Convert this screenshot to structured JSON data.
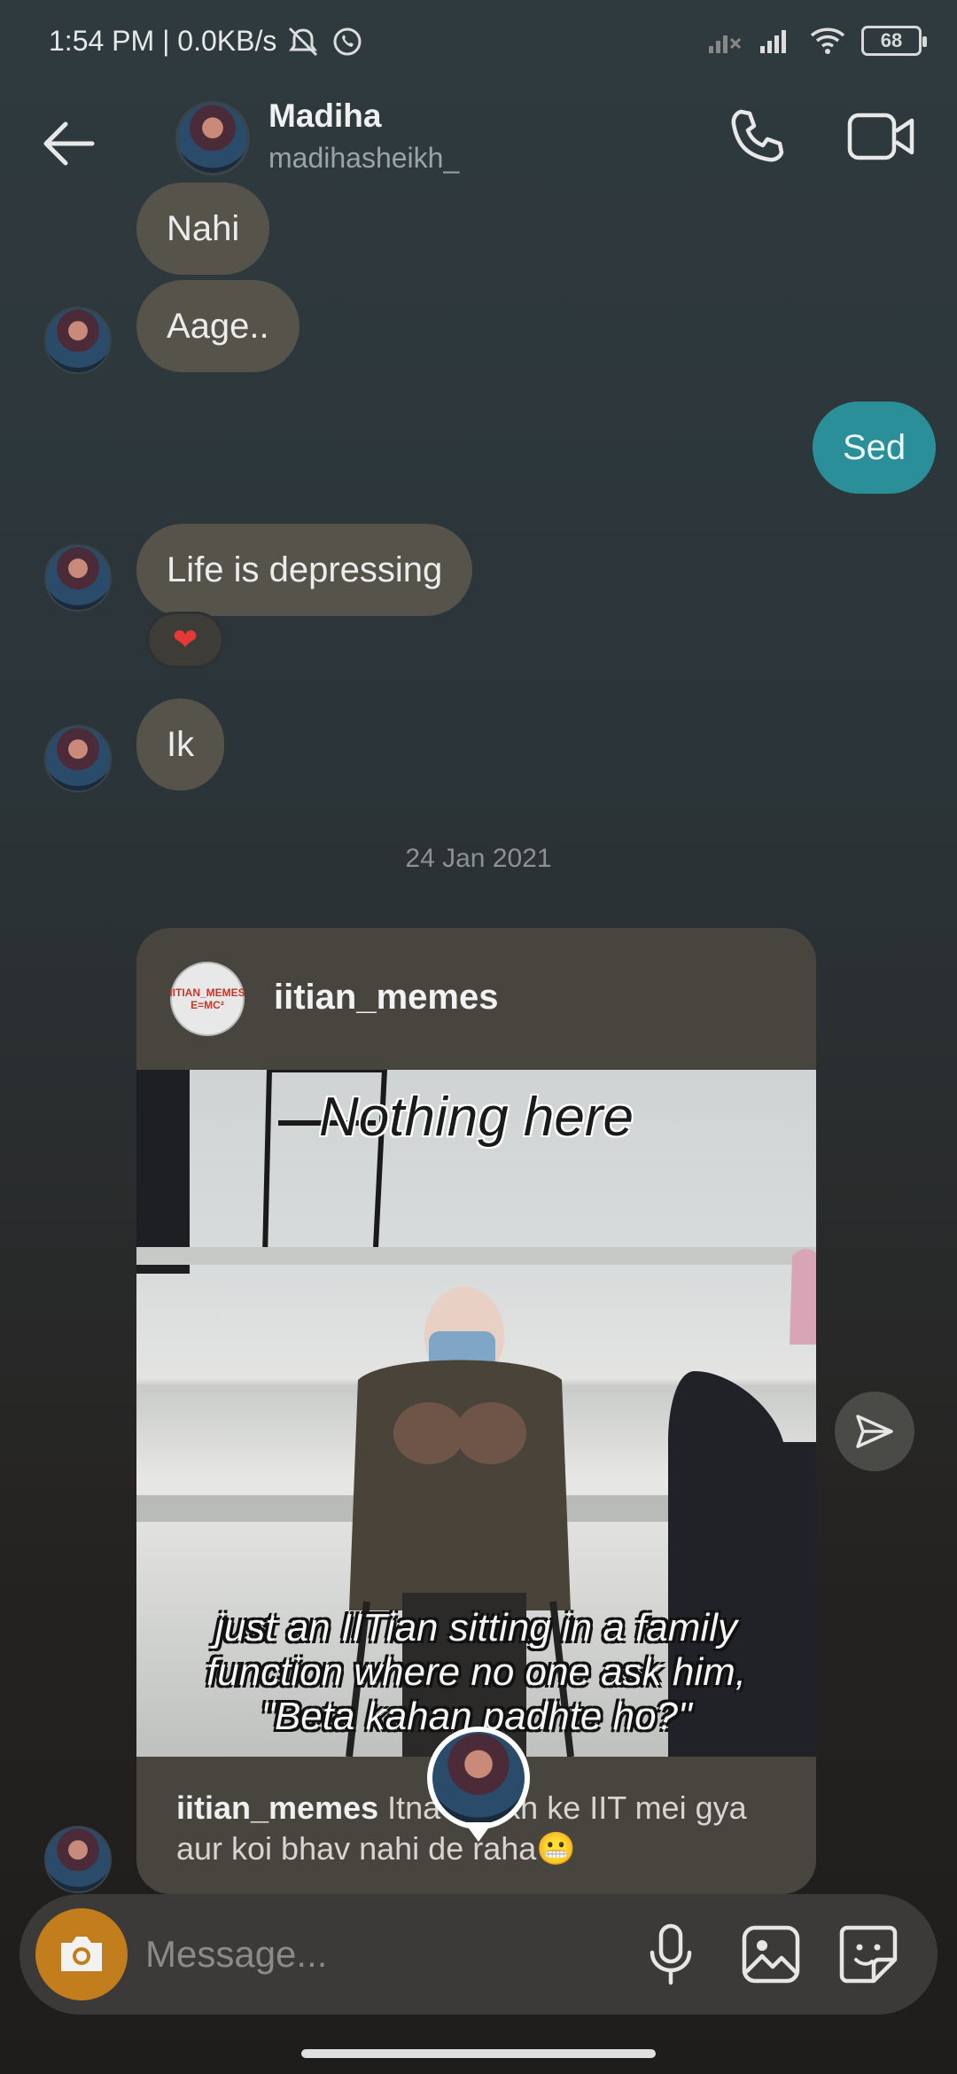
{
  "status_bar": {
    "time_speed": "1:54 PM | 0.0KB/s",
    "battery": "68"
  },
  "header": {
    "name": "Madiha",
    "handle": "madihasheikh_"
  },
  "messages": [
    {
      "text": "Nahi"
    },
    {
      "text": "Aage.."
    },
    {
      "text": "Sed"
    },
    {
      "text": "Life is depressing"
    },
    {
      "text": "Ik"
    }
  ],
  "reaction": "❤",
  "date_separator": "24 Jan 2021",
  "shared_post": {
    "username": "iitian_memes",
    "logo_text": "IITIAN_MEMES E=MC²",
    "meme_top": "Nothing here",
    "meme_bottom": "just an IITian sitting in a family function where no one ask him, \"Beta kahan padhte ho?\"",
    "caption_user": "iitian_memes",
    "caption_text": " Itna … likh ke IIT mei gya aur koi bhav nahi de raha😬"
  },
  "composer": {
    "placeholder": "Message..."
  },
  "colors": {
    "outgoing_bubble": "#2b8f99",
    "incoming_bubble": "#55534a",
    "camera_button": "#c27d1c"
  }
}
